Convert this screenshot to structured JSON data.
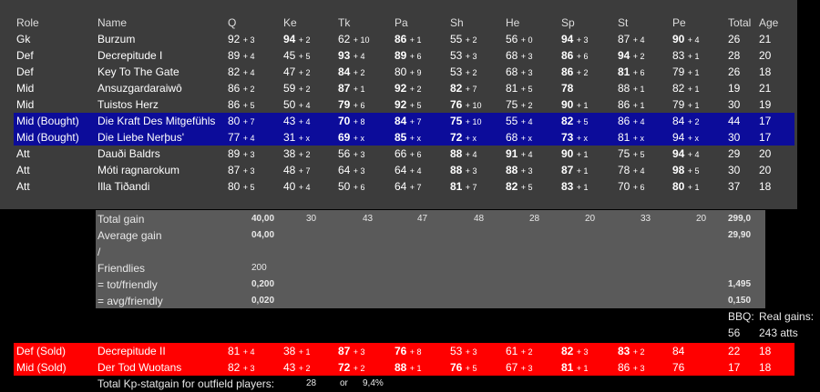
{
  "headers": {
    "role": "Role",
    "name": "Name",
    "q": "Q",
    "ke": "Ke",
    "tk": "Tk",
    "pa": "Pa",
    "sh": "Sh",
    "he": "He",
    "sp": "Sp",
    "st": "St",
    "pe": "Pe",
    "total": "Total",
    "age": "Age"
  },
  "players": [
    {
      "role": "Gk",
      "name": "Burzum",
      "stats": [
        [
          "92",
          "+ 3",
          0
        ],
        [
          "94",
          "+ 2",
          1
        ],
        [
          "62",
          "+ 10",
          0
        ],
        [
          "86",
          "+ 1",
          1
        ],
        [
          "55",
          "+ 2",
          0
        ],
        [
          "56",
          "+ 0",
          0
        ],
        [
          "94",
          "+ 3",
          1
        ],
        [
          "87",
          "+ 4",
          0
        ],
        [
          "90",
          "+ 4",
          1
        ]
      ],
      "total": "26",
      "age": "21"
    },
    {
      "role": "Def",
      "name": "Decrepitude I",
      "stats": [
        [
          "89",
          "+ 4",
          0
        ],
        [
          "45",
          "+ 5",
          0
        ],
        [
          "93",
          "+ 4",
          1
        ],
        [
          "89",
          "+ 6",
          1
        ],
        [
          "53",
          "+ 3",
          0
        ],
        [
          "68",
          "+ 3",
          0
        ],
        [
          "86",
          "+ 6",
          1
        ],
        [
          "94",
          "+ 2",
          1
        ],
        [
          "83",
          "+ 1",
          0
        ]
      ],
      "total": "28",
      "age": "20"
    },
    {
      "role": "Def",
      "name": "Key To The Gate",
      "stats": [
        [
          "82",
          "+ 4",
          0
        ],
        [
          "47",
          "+ 2",
          0
        ],
        [
          "84",
          "+ 2",
          1
        ],
        [
          "80",
          "+ 9",
          0
        ],
        [
          "53",
          "+ 2",
          0
        ],
        [
          "68",
          "+ 3",
          0
        ],
        [
          "86",
          "+ 2",
          1
        ],
        [
          "81",
          "+ 6",
          1
        ],
        [
          "79",
          "+ 1",
          0
        ]
      ],
      "total": "26",
      "age": "18"
    },
    {
      "role": "Mid",
      "name": "Ansuzgardaraiwô",
      "stats": [
        [
          "86",
          "+ 2",
          0
        ],
        [
          "59",
          "+ 2",
          0
        ],
        [
          "87",
          "+ 1",
          1
        ],
        [
          "92",
          "+ 2",
          1
        ],
        [
          "82",
          "+ 7",
          1
        ],
        [
          "81",
          "+ 5",
          0
        ],
        [
          "78",
          "",
          1
        ],
        [
          "88",
          "+ 1",
          0
        ],
        [
          "82",
          "+ 1",
          0
        ]
      ],
      "total": "19",
      "age": "21"
    },
    {
      "role": "Mid",
      "name": "Tuistos Herz",
      "stats": [
        [
          "86",
          "+ 5",
          0
        ],
        [
          "50",
          "+ 4",
          0
        ],
        [
          "79",
          "+ 6",
          1
        ],
        [
          "92",
          "+ 5",
          1
        ],
        [
          "76",
          "+ 10",
          1
        ],
        [
          "75",
          "+ 2",
          0
        ],
        [
          "90",
          "+ 1",
          1
        ],
        [
          "86",
          "+ 1",
          0
        ],
        [
          "79",
          "+ 1",
          0
        ]
      ],
      "total": "30",
      "age": "19"
    },
    {
      "role": "Mid (Bought)",
      "name": "Die Kraft Des Mitgefühls",
      "bought": true,
      "stats": [
        [
          "80",
          "+ 7",
          0
        ],
        [
          "43",
          "+ 4",
          0
        ],
        [
          "70",
          "+ 8",
          1
        ],
        [
          "84",
          "+ 7",
          1
        ],
        [
          "75",
          "+ 10",
          1
        ],
        [
          "55",
          "+ 4",
          0
        ],
        [
          "82",
          "+ 5",
          1
        ],
        [
          "86",
          "+ 4",
          0
        ],
        [
          "84",
          "+ 2",
          0
        ]
      ],
      "total": "44",
      "age": "17"
    },
    {
      "role": "Mid (Bought)",
      "name": "Die Liebe Nerþus'",
      "bought": true,
      "stats": [
        [
          "77",
          "+ 4",
          0
        ],
        [
          "31",
          "+ x",
          0
        ],
        [
          "69",
          "+ x",
          1
        ],
        [
          "85",
          "+ x",
          1
        ],
        [
          "72",
          "+ x",
          1
        ],
        [
          "68",
          "+ x",
          0
        ],
        [
          "73",
          "+ x",
          1
        ],
        [
          "81",
          "+ x",
          0
        ],
        [
          "94",
          "+ x",
          0
        ]
      ],
      "total": "30",
      "age": "17"
    },
    {
      "role": "Att",
      "name": "Dauði Baldrs",
      "stats": [
        [
          "89",
          "+ 3",
          0
        ],
        [
          "38",
          "+ 2",
          0
        ],
        [
          "56",
          "+ 3",
          0
        ],
        [
          "66",
          "+ 6",
          0
        ],
        [
          "88",
          "+ 4",
          1
        ],
        [
          "91",
          "+ 4",
          1
        ],
        [
          "90",
          "+ 1",
          1
        ],
        [
          "75",
          "+ 5",
          0
        ],
        [
          "94",
          "+ 4",
          1
        ]
      ],
      "total": "29",
      "age": "20"
    },
    {
      "role": "Att",
      "name": "Móti ragnarokum",
      "stats": [
        [
          "87",
          "+ 3",
          0
        ],
        [
          "48",
          "+ 7",
          0
        ],
        [
          "64",
          "+ 3",
          0
        ],
        [
          "64",
          "+ 4",
          0
        ],
        [
          "88",
          "+ 3",
          1
        ],
        [
          "88",
          "+ 3",
          1
        ],
        [
          "87",
          "+ 1",
          1
        ],
        [
          "78",
          "+ 4",
          0
        ],
        [
          "98",
          "+ 5",
          1
        ]
      ],
      "total": "30",
      "age": "20"
    },
    {
      "role": "Att",
      "name": "Illa Tiðandi",
      "stats": [
        [
          "80",
          "+ 5",
          0
        ],
        [
          "40",
          "+ 4",
          0
        ],
        [
          "50",
          "+ 6",
          0
        ],
        [
          "64",
          "+ 7",
          0
        ],
        [
          "81",
          "+ 7",
          1
        ],
        [
          "82",
          "+ 5",
          1
        ],
        [
          "83",
          "+ 1",
          1
        ],
        [
          "70",
          "+ 6",
          0
        ],
        [
          "80",
          "+ 1",
          1
        ]
      ],
      "total": "37",
      "age": "18"
    }
  ],
  "gains": {
    "total_label": "Total gain",
    "total_vals": [
      "40,00",
      "30",
      "43",
      "47",
      "48",
      "28",
      "20",
      "33",
      "20"
    ],
    "total_sum": "299,0",
    "avg_label": "Average gain",
    "avg_first": "04,00",
    "avg_sum": "29,90",
    "slash": "/",
    "friendlies_label": "Friendlies",
    "friendlies_val": "200",
    "tot_label": "=  tot/friendly",
    "tot_first": "0,200",
    "tot_sum": "1,495",
    "avgf_label": "=  avg/friendly",
    "avgf_first": "0,020",
    "avgf_sum": "0,150"
  },
  "bbq": {
    "label": "BBQ:",
    "real": "Real gains:",
    "val1": "56",
    "val2": "243 atts"
  },
  "sold": [
    {
      "role": "Def (Sold)",
      "name": "Decrepitude II",
      "stats": [
        [
          "81",
          "+ 4",
          0
        ],
        [
          "38",
          "+ 1",
          0
        ],
        [
          "87",
          "+ 3",
          1
        ],
        [
          "76",
          "+ 8",
          1
        ],
        [
          "53",
          "+ 3",
          0
        ],
        [
          "61",
          "+ 2",
          0
        ],
        [
          "82",
          "+ 3",
          1
        ],
        [
          "83",
          "+ 2",
          1
        ],
        [
          "84",
          "",
          0
        ]
      ],
      "total": "22",
      "age": "18"
    },
    {
      "role": "Mid (Sold)",
      "name": "Der Tod Wuotans",
      "stats": [
        [
          "82",
          "+ 3",
          0
        ],
        [
          "43",
          "+ 2",
          0
        ],
        [
          "72",
          "+ 2",
          1
        ],
        [
          "88",
          "+ 1",
          1
        ],
        [
          "76",
          "+ 5",
          1
        ],
        [
          "67",
          "+ 3",
          0
        ],
        [
          "81",
          "+ 1",
          1
        ],
        [
          "86",
          "+ 3",
          0
        ],
        [
          "76",
          "",
          0
        ]
      ],
      "total": "17",
      "age": "18"
    }
  ],
  "footer": {
    "label": "Total Kp-statgain for outfield players:",
    "val": "28",
    "or": "or",
    "pct": "9,4%"
  }
}
